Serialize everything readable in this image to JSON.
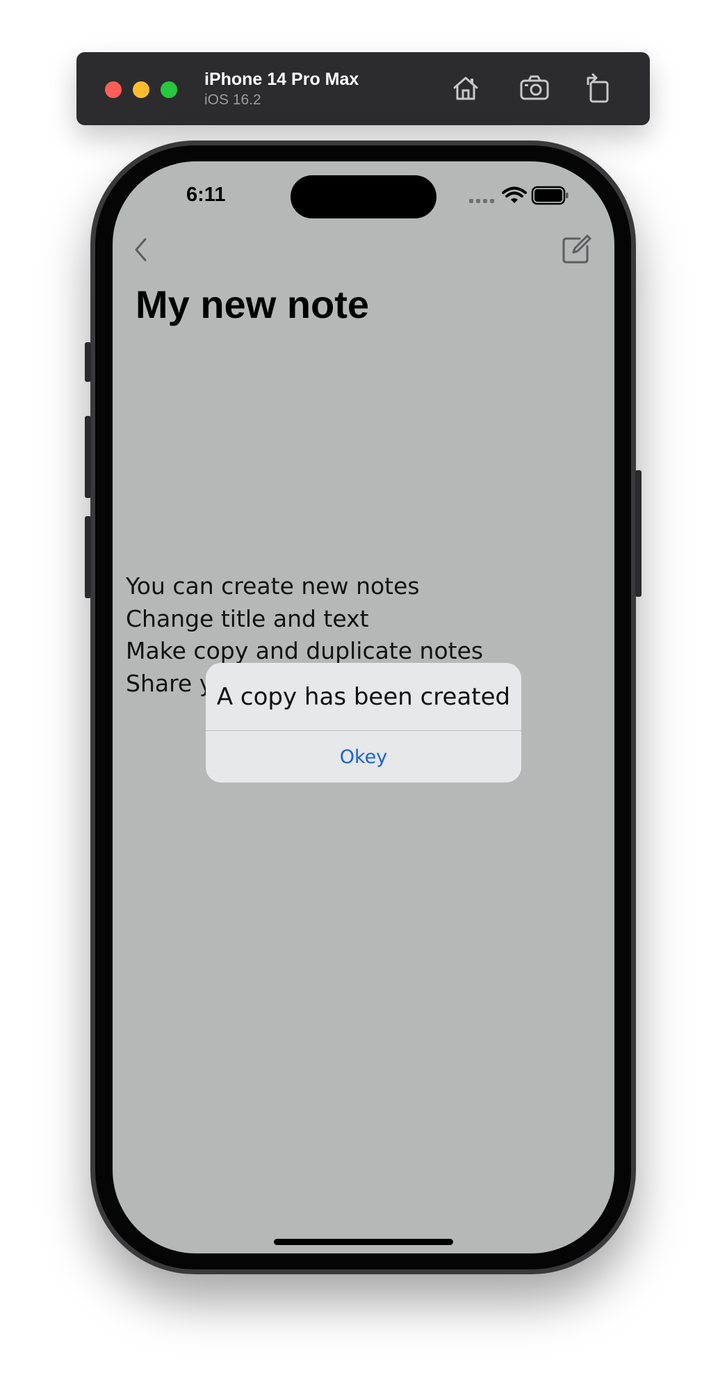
{
  "simulator": {
    "device_name": "iPhone 14 Pro Max",
    "os_version": "iOS 16.2",
    "toolbar_icons": [
      "home-icon",
      "screenshot-icon",
      "rotate-icon"
    ]
  },
  "status_bar": {
    "time": "6:11",
    "icons": [
      "cellular-signal-icon",
      "wifi-icon",
      "battery-icon"
    ]
  },
  "nav": {
    "back_icon": "chevron-left-icon",
    "compose_icon": "compose-icon"
  },
  "note": {
    "title": "My new note",
    "lines": [
      "You can create new notes",
      "Change title and text",
      "Make copy and duplicate notes",
      "Share y"
    ]
  },
  "alert": {
    "message": "A copy has been created",
    "button_label": "Okey"
  },
  "colors": {
    "screen_dimmed": "#b6b7b7",
    "alert_background": "#e6e8e9",
    "alert_button": "#1a63d6"
  }
}
